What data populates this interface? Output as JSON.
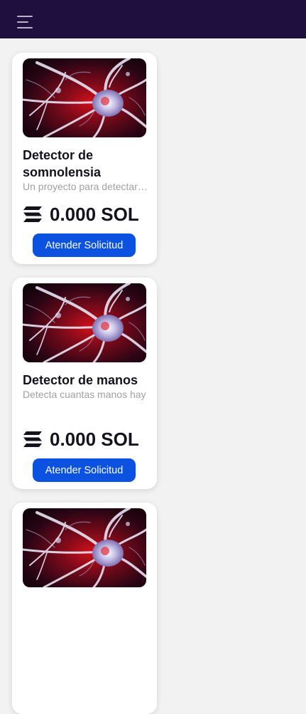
{
  "header": {
    "menu_icon": "hamburger-menu-icon",
    "background": "#1f0f3f"
  },
  "projects": [
    {
      "title": "Detector de somnolensia",
      "description": "Un proyecto para detectar somnolencia",
      "price": "0.000 SOL",
      "currency_icon": "solana-icon",
      "button_label": "Atender Solicitud",
      "image": "neuron-image"
    },
    {
      "title": "Detector de manos",
      "description": "Detecta cuantas manos hay",
      "price": "0.000 SOL",
      "currency_icon": "solana-icon",
      "button_label": "Atender Solicitud",
      "image": "neuron-image"
    },
    {
      "image": "neuron-image"
    }
  ],
  "colors": {
    "accent": "#0b52e0",
    "page_background": "#f2f2f2",
    "card_background": "#ffffff"
  }
}
